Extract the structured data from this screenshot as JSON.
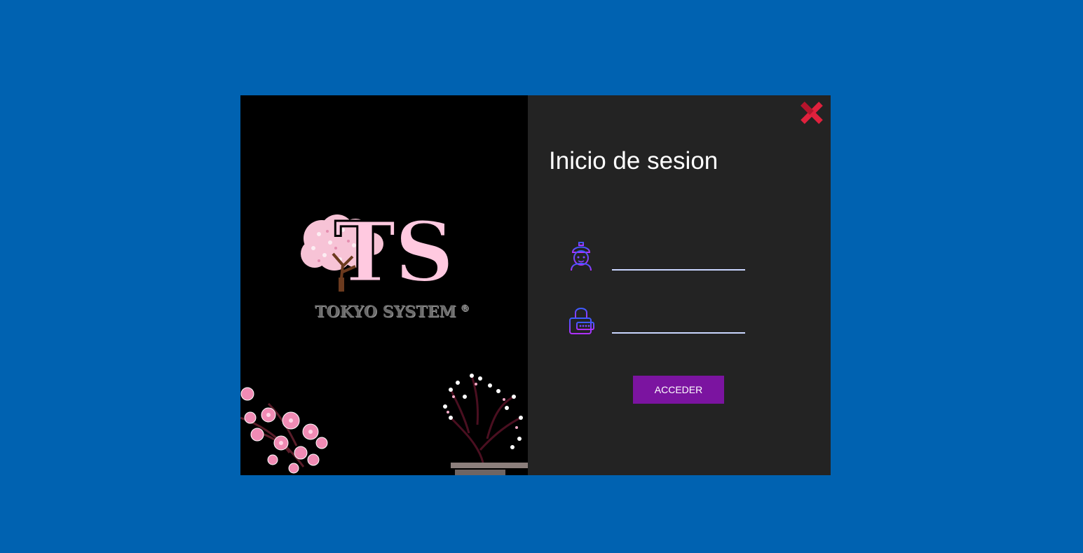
{
  "window": {
    "background_color": "#0062b1",
    "panel_dark": "#232323",
    "accent": "#7b14a0",
    "close_color": "#e0213d"
  },
  "brand": {
    "logo_letters": "TS",
    "logo_caption": "TOKYO SYSTEM",
    "logo_mark": "®",
    "logo_color": "#ffc9e0",
    "icons": [
      "cherry-tree-icon",
      "cherry-blossom-icon",
      "bonsai-icon"
    ]
  },
  "form": {
    "title": "Inicio de sesion",
    "username": {
      "icon": "user-icon",
      "value": "",
      "placeholder": ""
    },
    "password": {
      "icon": "lock-icon",
      "value": "",
      "placeholder": ""
    },
    "submit_label": "ACCEDER",
    "close_icon": "close-icon"
  }
}
